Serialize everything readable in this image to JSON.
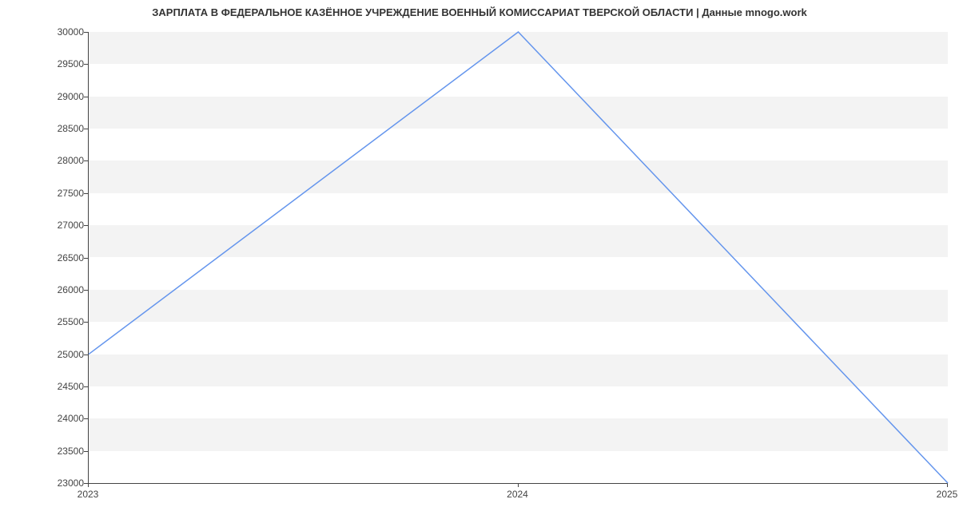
{
  "chart_data": {
    "type": "line",
    "title": "ЗАРПЛАТА В ФЕДЕРАЛЬНОЕ КАЗЁННОЕ УЧРЕЖДЕНИЕ ВОЕННЫЙ КОМИССАРИАТ ТВЕРСКОЙ ОБЛАСТИ | Данные mnogo.work",
    "x": [
      2023,
      2024,
      2025
    ],
    "x_labels": [
      "2023",
      "2024",
      "2025"
    ],
    "values": [
      25000,
      30000,
      23000
    ],
    "y_ticks": [
      23000,
      23500,
      24000,
      24500,
      25000,
      25500,
      26000,
      26500,
      27000,
      27500,
      28000,
      28500,
      29000,
      29500,
      30000
    ],
    "y_tick_labels": [
      "23000",
      "23500",
      "24000",
      "24500",
      "25000",
      "25500",
      "26000",
      "26500",
      "27000",
      "27500",
      "28000",
      "28500",
      "29000",
      "29500",
      "30000"
    ],
    "xlabel": "",
    "ylabel": "",
    "ylim": [
      23000,
      30000
    ],
    "xlim": [
      2023,
      2025
    ],
    "line_color": "#6495ed"
  }
}
